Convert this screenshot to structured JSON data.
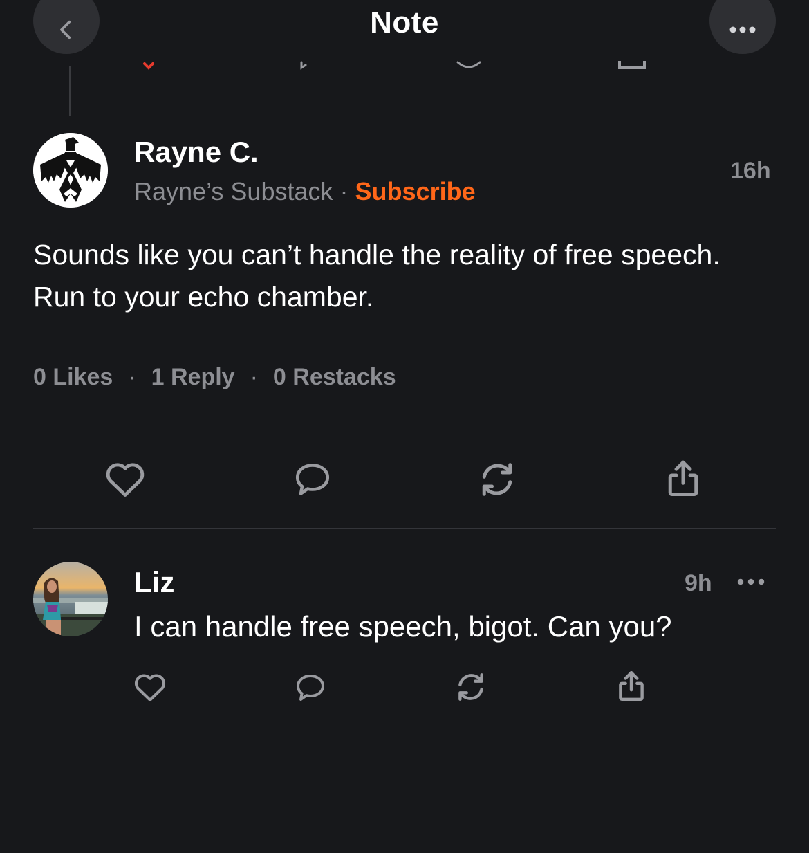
{
  "header": {
    "title": "Note"
  },
  "colors": {
    "background": "#17181b",
    "accent": "#ff6719",
    "muted_text": "#8d8e93",
    "divider": "#34353a"
  },
  "note": {
    "author": "Rayne C.",
    "publication": "Rayne’s Substack",
    "separator": "·",
    "subscribe_label": "Subscribe",
    "time": "16h",
    "body": "Sounds like you can’t handle the reality of free speech. Run to your echo chamber.",
    "stats": {
      "likes": "0 Likes",
      "replies": "1 Reply",
      "restacks": "0 Restacks",
      "separator": "·"
    },
    "actions": [
      "heart-icon",
      "comment-icon",
      "restack-icon",
      "share-icon"
    ]
  },
  "reply": {
    "author": "Liz",
    "time": "9h",
    "body": "I can handle free speech, bigot. Can you?",
    "actions": [
      "heart-icon",
      "comment-icon",
      "restack-icon",
      "share-icon"
    ]
  }
}
